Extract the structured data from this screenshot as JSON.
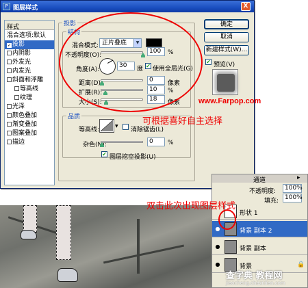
{
  "dialog": {
    "title": "图层样式",
    "close_label": "X"
  },
  "style_list": {
    "header": "样式",
    "items": [
      {
        "label": "混合选项:默认",
        "checked": null,
        "selected": false
      },
      {
        "label": "投影",
        "checked": true,
        "selected": true
      },
      {
        "label": "内阴影",
        "checked": false,
        "selected": false
      },
      {
        "label": "外发光",
        "checked": false,
        "selected": false
      },
      {
        "label": "内发光",
        "checked": false,
        "selected": false
      },
      {
        "label": "斜面和浮雕",
        "checked": false,
        "selected": false
      },
      {
        "label": "等高线",
        "checked": false,
        "selected": false
      },
      {
        "label": "纹理",
        "checked": false,
        "selected": false
      },
      {
        "label": "光泽",
        "checked": false,
        "selected": false
      },
      {
        "label": "颜色叠加",
        "checked": false,
        "selected": false
      },
      {
        "label": "渐变叠加",
        "checked": false,
        "selected": false
      },
      {
        "label": "图案叠加",
        "checked": false,
        "selected": false
      },
      {
        "label": "描边",
        "checked": false,
        "selected": false
      }
    ]
  },
  "drop_shadow": {
    "section_title": "投影",
    "structure_title": "结构",
    "blend_mode_label": "混合模式:",
    "blend_mode_value": "正片叠底",
    "shadow_color": "#000000",
    "opacity_label": "不透明度(O):",
    "opacity_value": "100",
    "percent": "%",
    "angle_label": "角度(A):",
    "angle_value": "30",
    "degree": "度",
    "global_light_label": "使用全局光(G)",
    "global_light_checked": true,
    "distance_label": "距离(D):",
    "distance_value": "0",
    "spread_label": "扩展(R):",
    "spread_value": "10",
    "size_label": "大小(S):",
    "size_value": "18",
    "pixel_unit": "像素",
    "quality_title": "品质",
    "contour_label": "等高线:",
    "anti_alias_label": "消除锯齿(L)",
    "anti_alias_checked": false,
    "noise_label": "杂色(N):",
    "noise_value": "0",
    "knockout_label": "图层挖空投影(U)",
    "knockout_checked": true
  },
  "buttons": {
    "ok": "确定",
    "cancel": "取消",
    "new_style": "新建样式(W)...",
    "preview_label": "预览(V)",
    "preview_checked": true
  },
  "annotations": {
    "url": "www.Farpop.com",
    "choose_text": "可根据喜好自主选择",
    "double_click_text": "双击此次出现图层样式",
    "color": "#ee0000"
  },
  "layers_panel": {
    "tab_label": "通道",
    "opacity_label": "不透明度:",
    "opacity_value": "100%",
    "fill_label": "填充:",
    "fill_value": "100%",
    "layers": [
      {
        "name": "形状 1",
        "selected": false
      },
      {
        "name": "背景 副本 2",
        "selected": true
      },
      {
        "name": "背景 副本",
        "selected": false
      },
      {
        "name": "背景",
        "selected": false
      }
    ]
  },
  "watermark": {
    "text": "查字典 教程网",
    "sub": "jiaocheng.chazidian.com"
  }
}
